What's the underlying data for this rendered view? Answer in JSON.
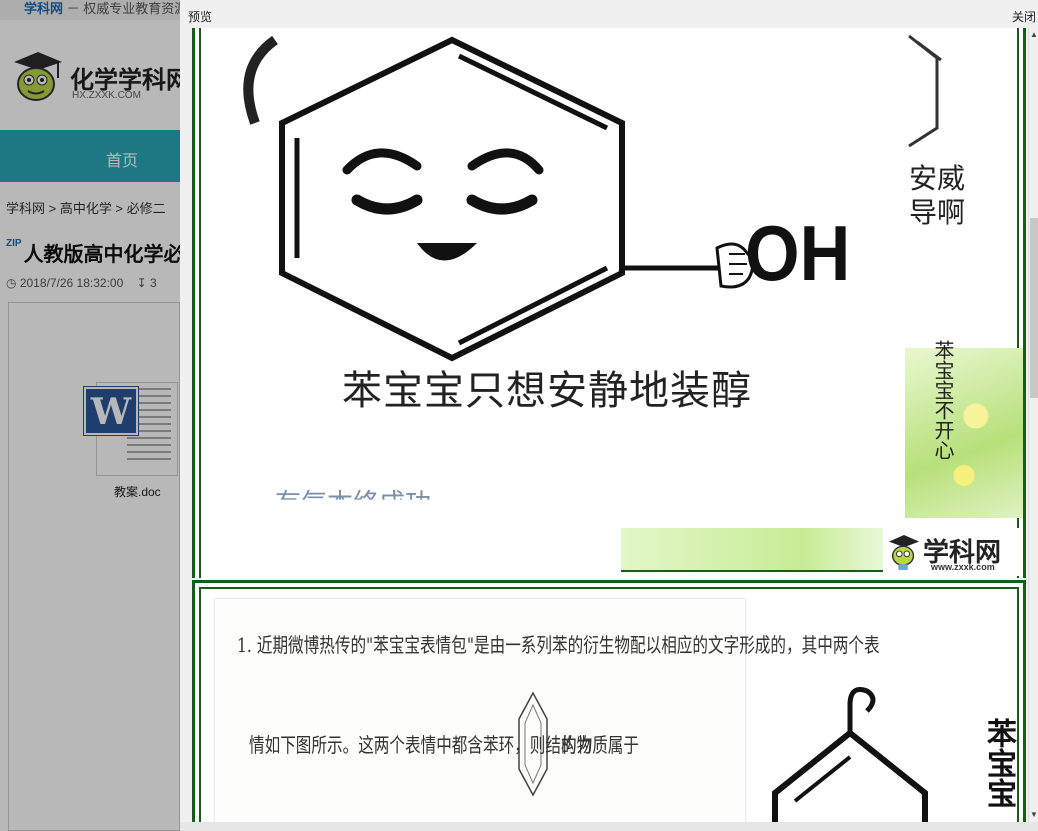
{
  "background_page": {
    "site_name": "学科网",
    "site_tagline": "－ 权威专业教育资源",
    "logo_title": "化学学科网",
    "logo_domain": "HX.ZXXK.COM",
    "nav_home": "首页",
    "breadcrumb": "学科网 > 高中化学 > 必修二",
    "file_type_badge": "ZIP",
    "doc_title": "人教版高中化学必修二",
    "upload_time": "2018/7/26 18:32:00",
    "download_count": "3",
    "doc_file_name": "教案.doc"
  },
  "dialog": {
    "title": "预览",
    "close_label": "关闭"
  },
  "preview": {
    "page1": {
      "caption": "苯宝宝只想安静地装醇",
      "oh_group": "OH",
      "side_text_line1": "安威",
      "side_text_line2": "导啊",
      "vertical_text": "苯宝宝不开心",
      "partial_bottom_text": "有气本终成功",
      "watermark_name": "学科网",
      "watermark_url": "www.zxxk.com"
    },
    "page2": {
      "question_line1": "1. 近期微博热传的\"苯宝宝表情包\"是由一系列苯的衍生物配以相应的文字形成的，其中两个表",
      "question_line2": "情如下图所示。这两个表情中都含苯环，则结构为",
      "question_line3": "的物质属于",
      "right_vertical_text": "苯宝宝"
    }
  },
  "colors": {
    "nav_teal": "#2aa7b8",
    "frame_green": "#185c1a",
    "link_blue": "#1a6bb8"
  }
}
